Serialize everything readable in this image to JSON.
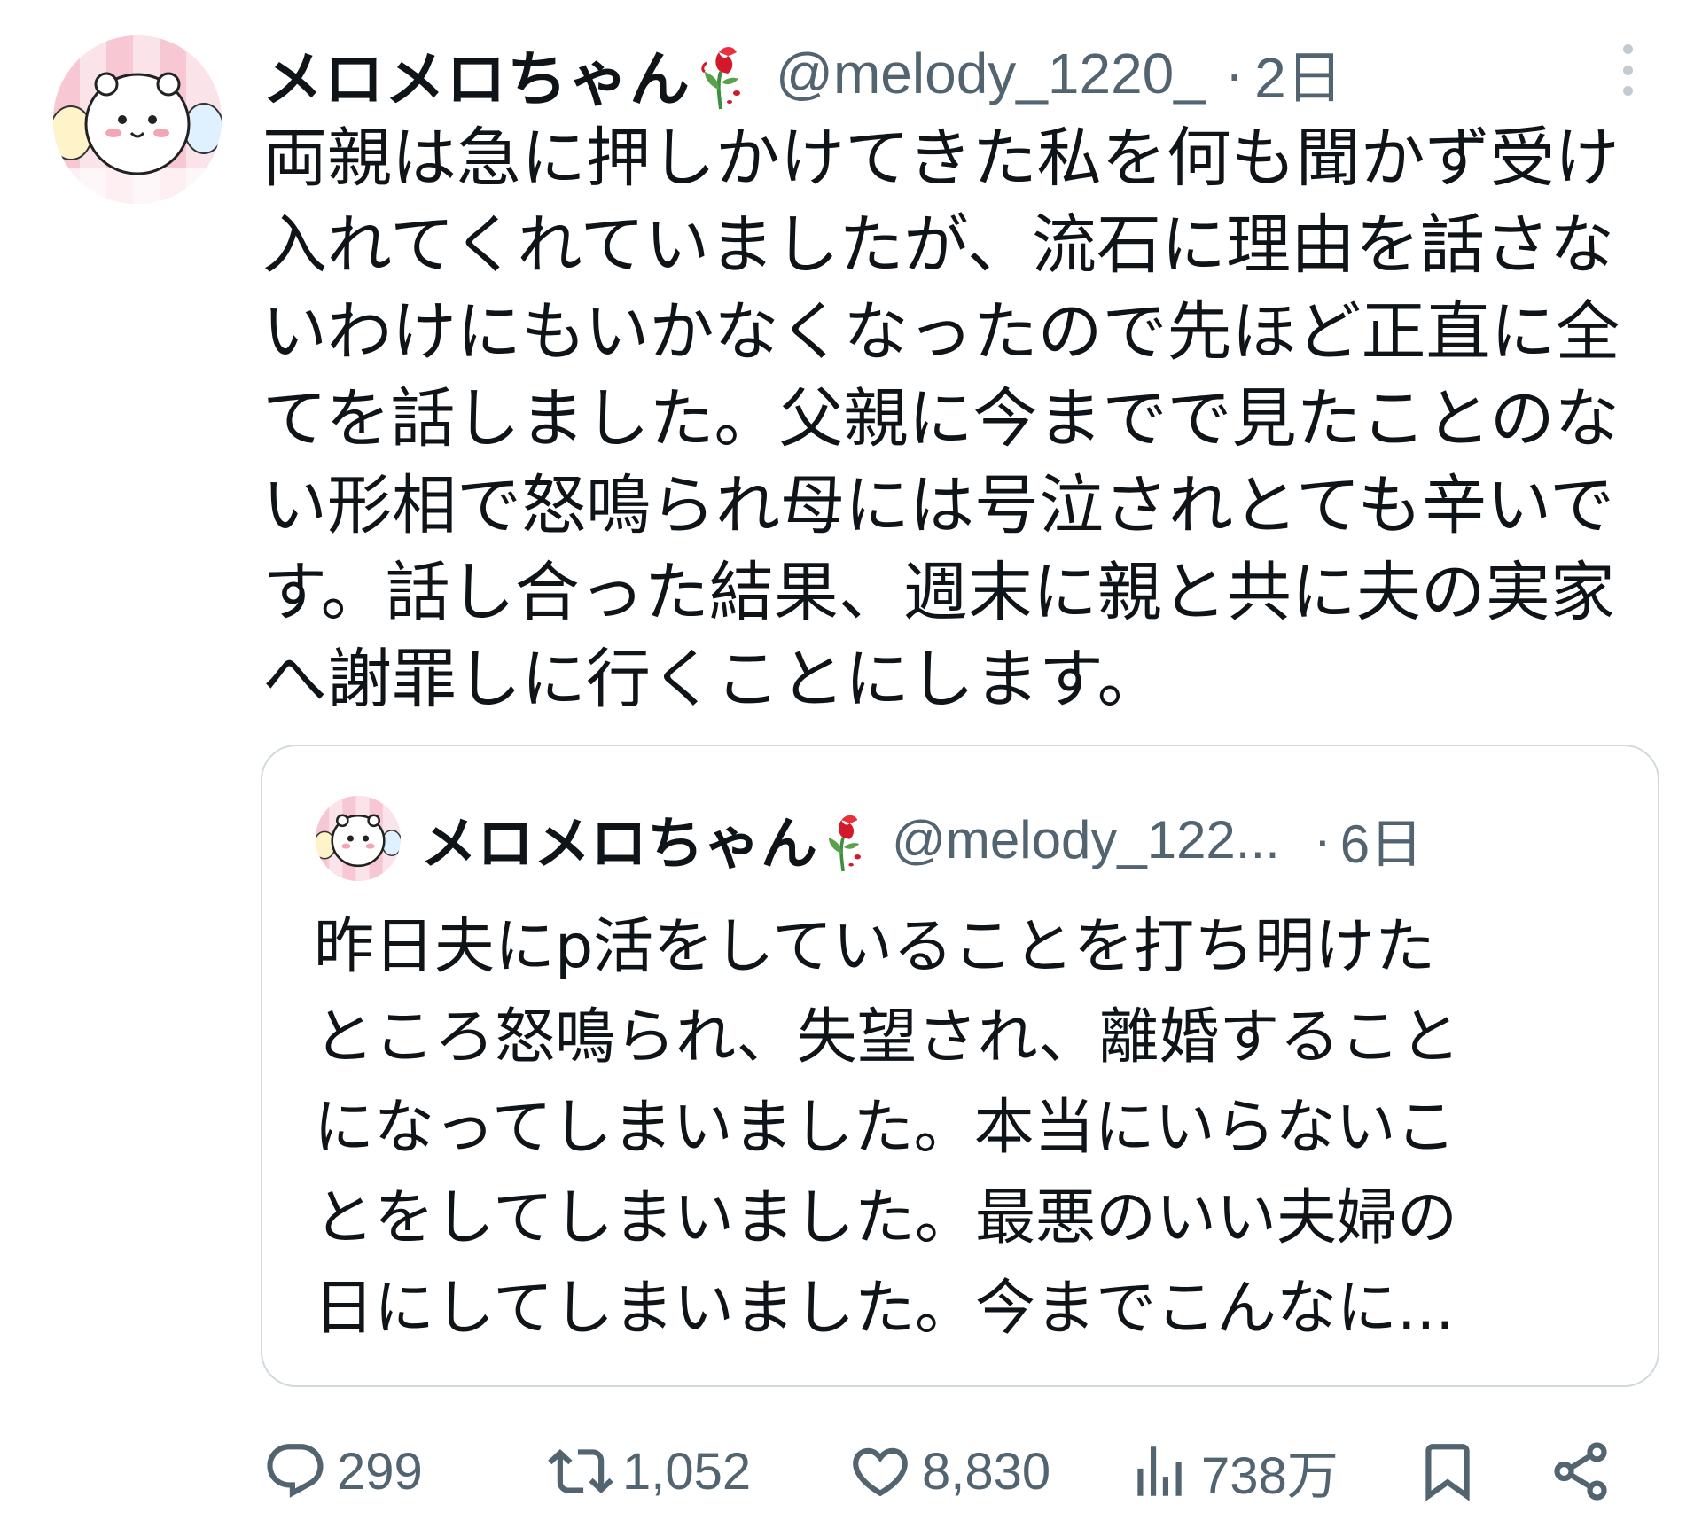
{
  "tweet": {
    "display_name": "メロメロちゃん",
    "handle": "@melody_1220_",
    "separator": "·",
    "timestamp": "2日",
    "text": "両親は急に押しかけてきた私を何も聞かず受け\n入れてくれていましたが、流石に理由を話さな\nいわけにもいかなくなったので先ほど正直に全\nてを話しました。父親に今までで見たことのな\nい形相で怒鳴られ母には号泣されとても辛いで\nす。話し合った結果、週末に親と共に夫の実家\nへ謝罪しに行くことにします。"
  },
  "quoted_tweet": {
    "display_name": "メロメロちゃん",
    "handle": "@melody_122...",
    "separator": "·",
    "timestamp": "6日",
    "text": "昨日夫にp活をしていることを打ち明けた\nところ怒鳴られ、失望され、離婚すること\nになってしまいました。本当にいらないこ\nとをしてしまいました。最悪のいい夫婦の\n日にしてしまいました。今までこんなに..."
  },
  "actions": {
    "replies": "299",
    "reposts": "1,052",
    "likes": "8,830",
    "views": "738万"
  },
  "icons": {
    "reply": "reply-bubble-icon",
    "repost": "repost-arrows-icon",
    "like": "heart-icon",
    "views": "bar-chart-icon",
    "bookmark": "bookmark-icon",
    "share": "share-icon",
    "badge": "wilted-rose-icon",
    "more": "more-dots-icon"
  },
  "colors": {
    "text": "#0f1419",
    "secondary": "#536471",
    "border": "#cfd9de",
    "rose": "#d3182b"
  }
}
